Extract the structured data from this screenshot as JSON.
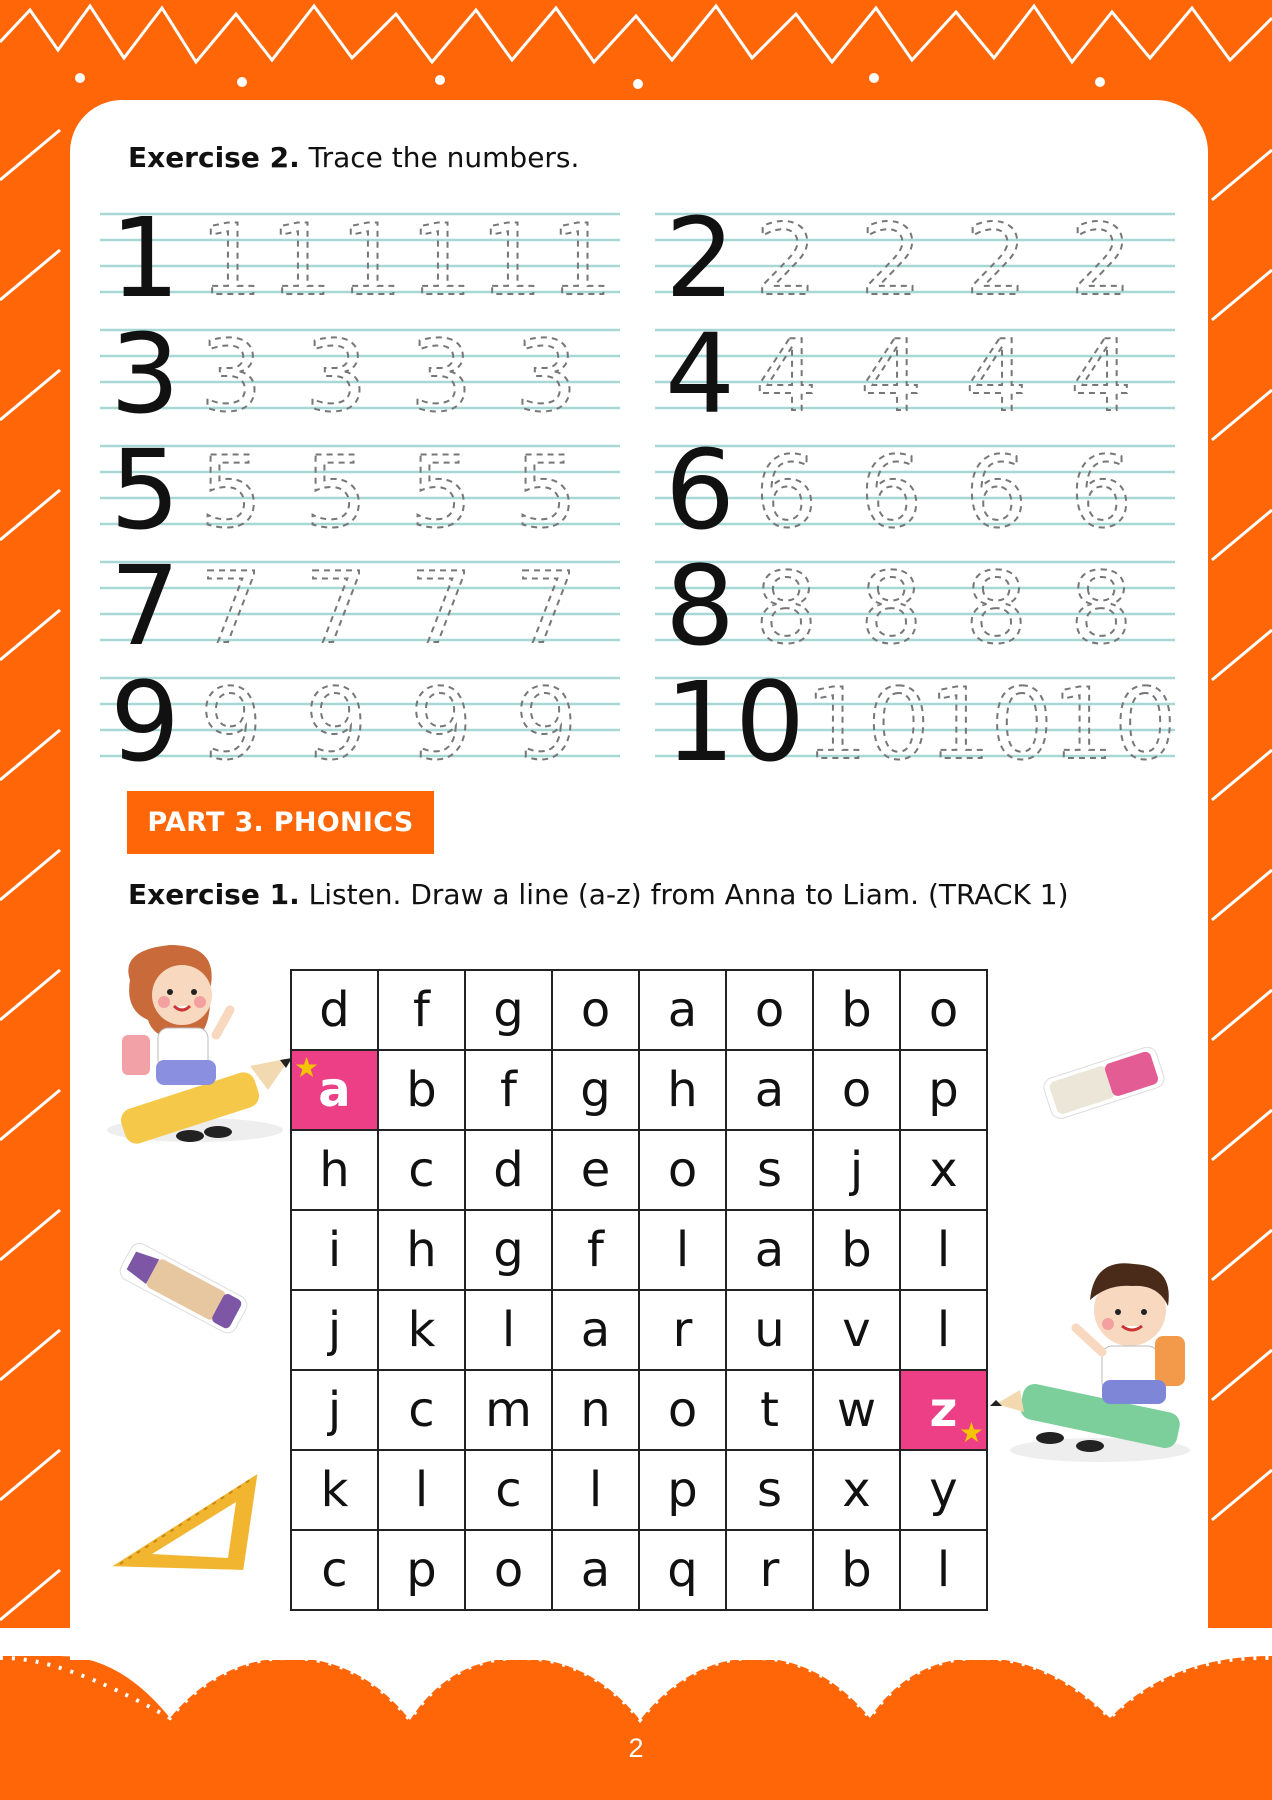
{
  "exercise2": {
    "label": "Exercise 2.",
    "text": " Trace the numbers.",
    "rows": [
      {
        "num": "1",
        "trace": [
          "1",
          "1",
          "1",
          "1",
          "1",
          "1"
        ]
      },
      {
        "num": "2",
        "trace": [
          "2",
          "2",
          "2",
          "2"
        ]
      },
      {
        "num": "3",
        "trace": [
          "3",
          "3",
          "3",
          "3"
        ]
      },
      {
        "num": "4",
        "trace": [
          "4",
          "4",
          "4",
          "4"
        ]
      },
      {
        "num": "5",
        "trace": [
          "5",
          "5",
          "5",
          "5"
        ]
      },
      {
        "num": "6",
        "trace": [
          "6",
          "6",
          "6",
          "6"
        ]
      },
      {
        "num": "7",
        "trace": [
          "7",
          "7",
          "7",
          "7"
        ]
      },
      {
        "num": "8",
        "trace": [
          "8",
          "8",
          "8",
          "8"
        ]
      },
      {
        "num": "9",
        "trace": [
          "9",
          "9",
          "9",
          "9"
        ]
      },
      {
        "num": "10",
        "trace": [
          "10",
          "10",
          "10"
        ]
      }
    ]
  },
  "part3": {
    "title": "PART 3. PHONICS"
  },
  "exercise1": {
    "label": "Exercise 1.",
    "text": " Listen. Draw a line (a-z) from Anna to Liam. (TRACK 1)"
  },
  "letter_grid": [
    [
      "d",
      "f",
      "g",
      "o",
      "a",
      "o",
      "b",
      "o"
    ],
    [
      "a",
      "b",
      "f",
      "g",
      "h",
      "a",
      "o",
      "p"
    ],
    [
      "h",
      "c",
      "d",
      "e",
      "o",
      "s",
      "j",
      "x"
    ],
    [
      "i",
      "h",
      "g",
      "f",
      "l",
      "a",
      "b",
      "l"
    ],
    [
      "j",
      "k",
      "l",
      "a",
      "r",
      "u",
      "v",
      "l"
    ],
    [
      "j",
      "c",
      "m",
      "n",
      "o",
      "t",
      "w",
      "z"
    ],
    [
      "k",
      "l",
      "c",
      "l",
      "p",
      "s",
      "x",
      "y"
    ],
    [
      "c",
      "p",
      "o",
      "a",
      "q",
      "r",
      "b",
      "l"
    ]
  ],
  "highlight_color": "#ec3f86",
  "accent_color": "#ff6608",
  "page_number": "2"
}
